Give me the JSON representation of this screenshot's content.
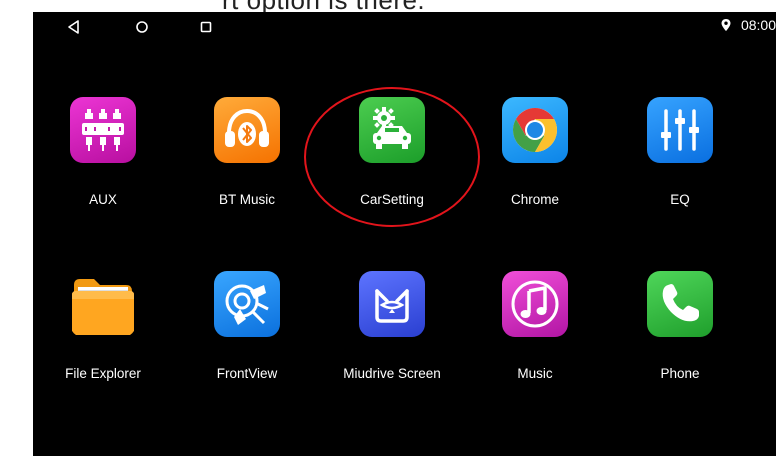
{
  "caption": "rt option is there. ",
  "status_bar": {
    "time": "08:00",
    "location_icon": "location-pin-icon",
    "nav": [
      {
        "name": "back-icon"
      },
      {
        "name": "home-icon"
      },
      {
        "name": "recents-icon"
      }
    ]
  },
  "apps": [
    {
      "label": "AUX",
      "icon": "aux-icon",
      "color": "#d61fb8"
    },
    {
      "label": "BT Music",
      "icon": "bluetooth-headphones-icon",
      "color": "#ff8a1c"
    },
    {
      "label": "CarSetting",
      "icon": "car-settings-icon",
      "color": "#2db53c"
    },
    {
      "label": "Chrome",
      "icon": "chrome-icon",
      "color": "#1ea7ff"
    },
    {
      "label": "EQ",
      "icon": "equalizer-icon",
      "color": "#1a8cff"
    },
    {
      "label": "File Explorer",
      "icon": "folder-icon",
      "color": "#ffa71a"
    },
    {
      "label": "FrontView",
      "icon": "frontview-icon",
      "color": "#1e90ff"
    },
    {
      "label": "Miudrive Screen",
      "icon": "miudrive-icon",
      "color": "#3c55e0"
    },
    {
      "label": "Music",
      "icon": "music-note-icon",
      "color": "#e02fc8"
    },
    {
      "label": "Phone",
      "icon": "phone-icon",
      "color": "#2dbf3a"
    }
  ],
  "highlight_color": "#e2141b"
}
